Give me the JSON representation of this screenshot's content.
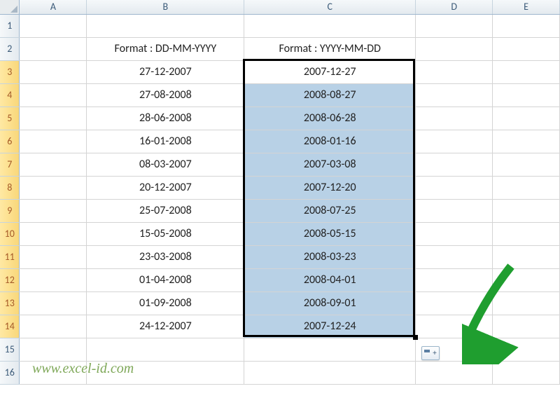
{
  "columns": [
    "A",
    "B",
    "C",
    "D",
    "E"
  ],
  "rowCount": 16,
  "headers": {
    "B": "Format : DD-MM-YYYY",
    "C": "Format : YYYY-MM-DD"
  },
  "data": [
    {
      "b": "27-12-2007",
      "c": "2007-12-27"
    },
    {
      "b": "27-08-2008",
      "c": "2008-08-27"
    },
    {
      "b": "28-06-2008",
      "c": "2008-06-28"
    },
    {
      "b": "16-01-2008",
      "c": "2008-01-16"
    },
    {
      "b": "08-03-2007",
      "c": "2007-03-08"
    },
    {
      "b": "20-12-2007",
      "c": "2007-12-20"
    },
    {
      "b": "25-07-2008",
      "c": "2008-07-25"
    },
    {
      "b": "15-05-2008",
      "c": "2008-05-15"
    },
    {
      "b": "23-03-2008",
      "c": "2008-03-23"
    },
    {
      "b": "01-04-2008",
      "c": "2008-04-01"
    },
    {
      "b": "01-09-2008",
      "c": "2008-09-01"
    },
    {
      "b": "24-12-2007",
      "c": "2007-12-24"
    }
  ],
  "watermark": "www.excel-id.com",
  "selection": {
    "col": "C",
    "startRow": 3,
    "endRow": 14
  }
}
